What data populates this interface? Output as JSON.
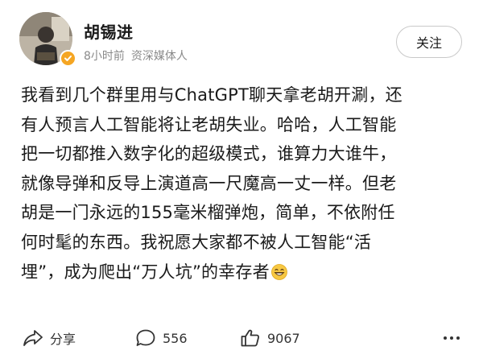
{
  "author": {
    "name": "胡锡进",
    "time": "8小时前",
    "tag": "资深媒体人",
    "follow_label": "关注"
  },
  "post": {
    "lines": [
      "我看到几个群里用与ChatGPT聊天拿老胡开涮，还",
      "有人预言人工智能将让老胡失业。哈哈，人工智能",
      "把一切都推入数字化的超级模式，谁算力大谁牛，",
      "就像导弹和反导上演道高一尺魔高一丈一样。但老",
      "胡是一门永远的155毫米榴弹炮，简单，不依附任",
      "何时髦的东西。我祝愿大家都不被人工智能“活",
      "埋”，成为爬出“万人坑”的幸存者"
    ],
    "emoji": "grinning-face-emoji"
  },
  "actions": {
    "share_label": "分享",
    "comment_count": "556",
    "like_count": "9067",
    "share_icon": "share-icon",
    "comment_icon": "comment-icon",
    "like_icon": "thumbs-up-icon",
    "more_icon": "more-icon"
  },
  "colors": {
    "text": "#1a1a1a",
    "meta": "#8a8a8a",
    "badge": "#f5a623",
    "button_border": "#c9c9c9"
  }
}
